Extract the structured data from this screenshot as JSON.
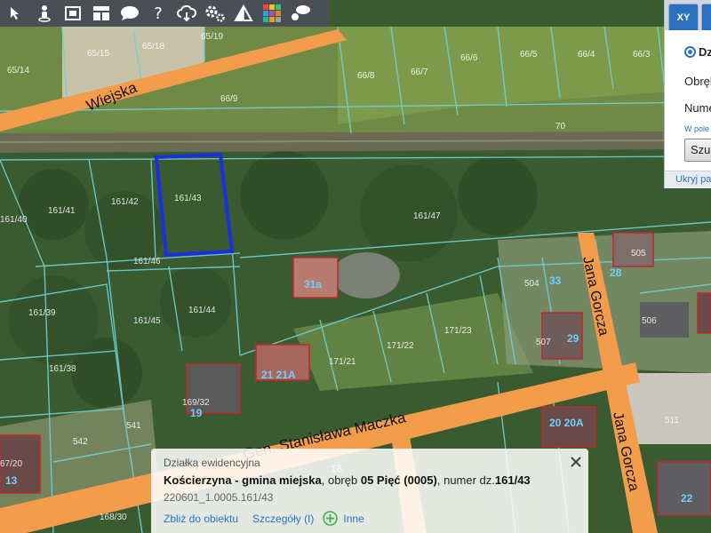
{
  "toolbar": {
    "tools": [
      {
        "name": "identify",
        "icon": "identify-icon"
      },
      {
        "name": "street-view",
        "icon": "pegman-icon"
      },
      {
        "name": "print",
        "icon": "print-icon"
      },
      {
        "name": "layout",
        "icon": "layout-icon"
      },
      {
        "name": "comments",
        "icon": "comment-icon"
      },
      {
        "name": "help",
        "icon": "help-icon",
        "glyph": "?"
      },
      {
        "name": "cloud",
        "icon": "cloud-download-icon"
      },
      {
        "name": "settings",
        "icon": "gears-icon"
      },
      {
        "name": "measure",
        "icon": "measure-icon"
      },
      {
        "name": "layers",
        "icon": "layers-grid-icon"
      },
      {
        "name": "messages",
        "icon": "chat-icon"
      }
    ],
    "background": "#4a4f57"
  },
  "search_panel": {
    "tab_xy": "XY",
    "radio_label": "Dz",
    "field_obreb": "Obręb",
    "field_numer": "Numer",
    "hint": "W pole",
    "button": "Szuk",
    "footer": "Ukryj pa"
  },
  "map": {
    "road_labels": {
      "wiejska": "Wiejska",
      "maczka": "Gen. Stanisława Maczka",
      "gorcza_1": "Jana Gorcza",
      "gorcza_2": "Jana Gorcza"
    },
    "parcel_labels": {
      "p65_19": "65/19",
      "p65_15": "65/15",
      "p65_18": "65/18",
      "p65_14": "65/14",
      "p66_8": "66/8",
      "p66_7": "66/7",
      "p66_6": "66/6",
      "p66_5": "66/5",
      "p66_4": "66/4",
      "p66_3": "66/3",
      "p66_9": "66/9",
      "p70": "70",
      "p161_43": "161/43",
      "p161_42": "161/42",
      "p161_41": "161/41",
      "p161_40": "161/40",
      "p161_47": "161/47",
      "p161_46": "161/46",
      "p161_39": "161/39",
      "p161_45": "161/45",
      "p161_44": "161/44",
      "p161_38": "161/38",
      "p171_21": "171/21",
      "p171_22": "171/22",
      "p171_23": "171/23",
      "p169_32": "169/32",
      "p542": "542",
      "p541": "541",
      "p504": "504",
      "p505": "505",
      "p506": "506",
      "p507": "507",
      "p511": "511",
      "p168_30": "168/30",
      "p67_20": "67/20"
    },
    "building_numbers": {
      "b31a": "31a",
      "b28": "28",
      "b33": "33",
      "b29": "29",
      "b21a": "21 21A",
      "b19": "19",
      "b20": "20 20A",
      "b13": "13",
      "b16": "16",
      "b22": "22"
    },
    "selection_color": "#1a2fe0",
    "road_color": "#f39c4c",
    "parcel_line_color": "#6fd0d4"
  },
  "popup": {
    "type": "Działka ewidencyjna",
    "place": "Kościerzyna - gmina miejska",
    "mid": ", obręb ",
    "precinct": "05 Pięć (0005)",
    "mid2": ", numer dz.",
    "parcel": "161/43",
    "code": "220601_1.0005.161/43",
    "link_zoom": "Zbliż do obiektu",
    "link_details": "Szczegóły (I)",
    "link_other": "Inne"
  }
}
